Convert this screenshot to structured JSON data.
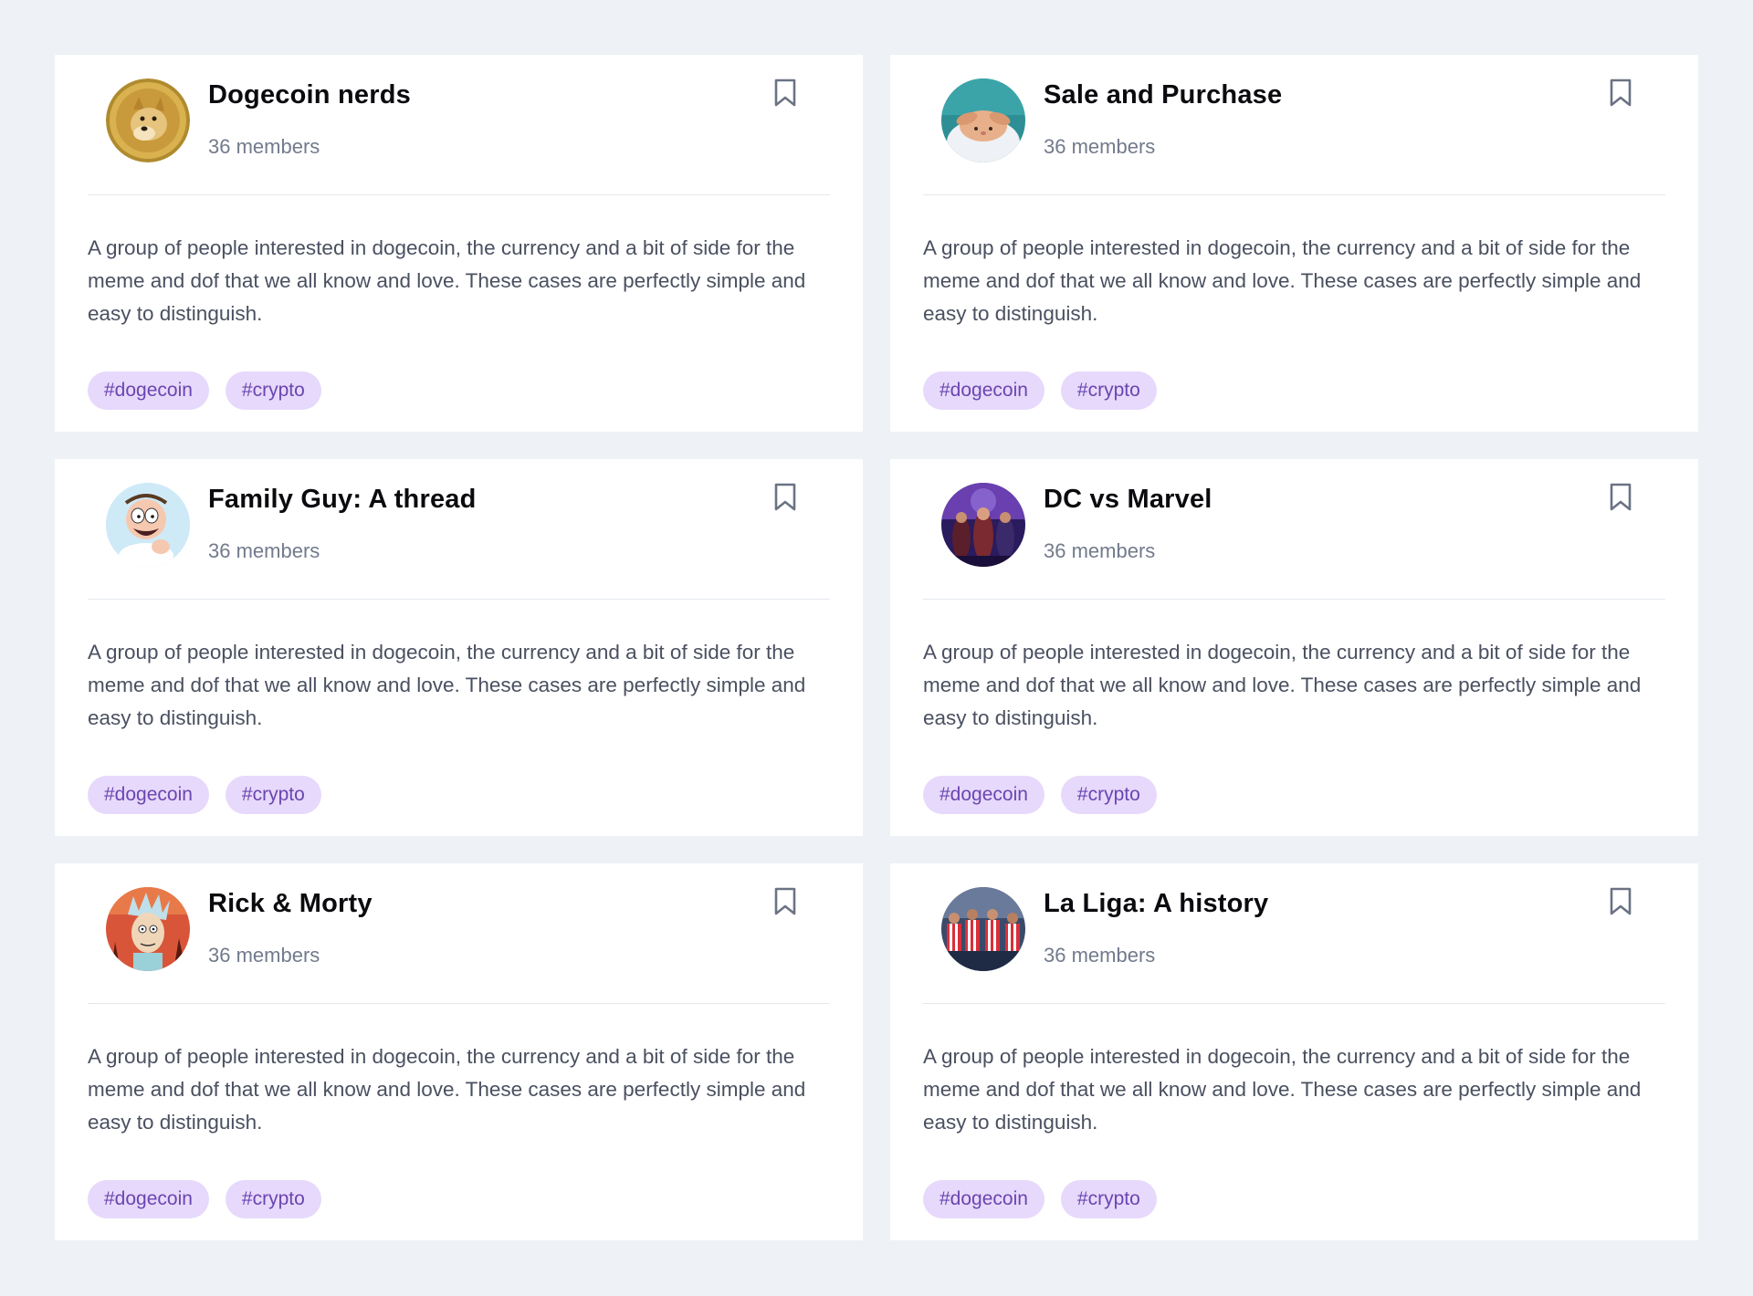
{
  "colors": {
    "background": "#eef1f5",
    "card": "#ffffff",
    "tag_bg": "#e7d9fb",
    "tag_text": "#6b45b0",
    "muted": "#727a8c"
  },
  "groups": [
    {
      "name": "Dogecoin nerds",
      "members": "36 members",
      "description": "A group of people interested in dogecoin, the currency and a bit of side for the meme and dof that we all know and love. These cases are perfectly simple and easy to distinguish.",
      "tags": [
        "#dogecoin",
        "#crypto"
      ],
      "avatar": "doge-avatar"
    },
    {
      "name": "Sale and Purchase",
      "members": "36 members",
      "description": "A group of people interested in dogecoin, the currency and a bit of side for the meme and dof that we all know and love. These cases are perfectly simple and easy to distinguish.",
      "tags": [
        "#dogecoin",
        "#crypto"
      ],
      "avatar": "bunny-avatar"
    },
    {
      "name": "Family Guy: A thread",
      "members": "36 members",
      "description": "A group of people interested in dogecoin, the currency and a bit of side for the meme and dof that we all know and love. These cases are perfectly simple and easy to distinguish.",
      "tags": [
        "#dogecoin",
        "#crypto"
      ],
      "avatar": "peter-griffin-avatar"
    },
    {
      "name": "DC vs Marvel",
      "members": "36 members",
      "description": "A group of people interested in dogecoin, the currency and a bit of side for the meme and dof that we all know and love. These cases are perfectly simple and easy to distinguish.",
      "tags": [
        "#dogecoin",
        "#crypto"
      ],
      "avatar": "superheroes-avatar"
    },
    {
      "name": "Rick & Morty",
      "members": "36 members",
      "description": "A group of people interested in dogecoin, the currency and a bit of side for the meme and dof that we all know and love. These cases are perfectly simple and easy to distinguish.",
      "tags": [
        "#dogecoin",
        "#crypto"
      ],
      "avatar": "rick-avatar"
    },
    {
      "name": "La Liga: A history",
      "members": "36 members",
      "description": "A group of people interested in dogecoin, the currency and a bit of side for the meme and dof that we all know and love. These cases are perfectly simple and easy to distinguish.",
      "tags": [
        "#dogecoin",
        "#crypto"
      ],
      "avatar": "football-team-avatar"
    }
  ]
}
